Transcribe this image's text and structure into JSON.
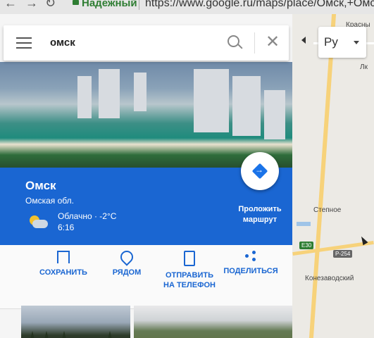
{
  "browser": {
    "secure_label": "Надежный",
    "url": "https://www.google.ru/maps/place/Омск,+Омск"
  },
  "search": {
    "query": "омск"
  },
  "language": {
    "selected": "Ру"
  },
  "place": {
    "name": "Омск",
    "region": "Омская обл.",
    "weather": "Облачно · -2°C",
    "local_time": "6:16",
    "route_label": "Проложить маршрут"
  },
  "actions": [
    {
      "label": "СОХРАНИТЬ"
    },
    {
      "label": "РЯДОМ"
    },
    {
      "label": "ОТПРАВИТЬ НА ТЕЛЕФОН"
    },
    {
      "label": "ПОДЕЛИТЬСЯ"
    }
  ],
  "map": {
    "labels": {
      "krasnyi": "Красны",
      "lk": "Лк",
      "stepnoe": "Степное",
      "konezavodsky": "Конезаводский"
    },
    "shields": {
      "e30": "E30",
      "p254": "P-254"
    }
  },
  "colors": {
    "brand_blue": "#1a66d2",
    "action_blue": "#1a73e8"
  }
}
